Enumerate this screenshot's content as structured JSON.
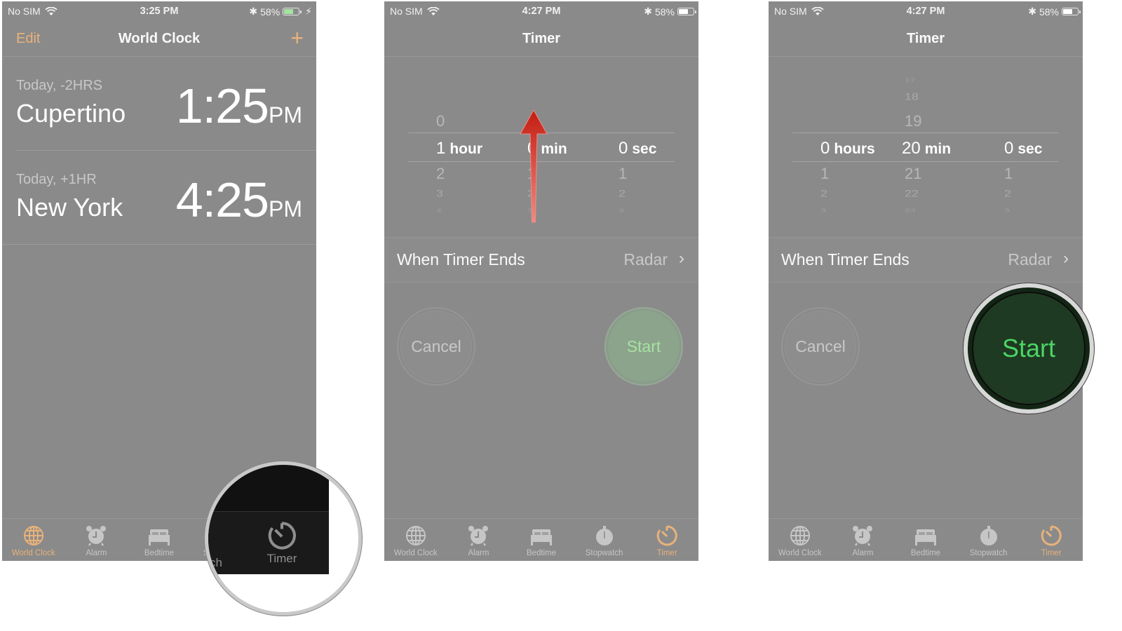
{
  "status_bar_common": {
    "carrier": "No SIM",
    "battery": "58%"
  },
  "panels": [
    {
      "status_time": "3:25 PM",
      "nav": {
        "edit_label": "Edit",
        "title": "World Clock",
        "add_icon": "plus-icon"
      },
      "clocks": [
        {
          "offset": "Today, -2HRS",
          "city": "Cupertino",
          "time": "1:25",
          "ampm": "PM"
        },
        {
          "offset": "Today, +1HR",
          "city": "New York",
          "time": "4:25",
          "ampm": "PM"
        }
      ],
      "magnifier": {
        "partial_label": "ch",
        "highlight_label": "Timer"
      }
    },
    {
      "status_time": "4:27 PM",
      "nav": {
        "title": "Timer"
      },
      "picker": {
        "hours": {
          "above": [
            "0"
          ],
          "selected": "1",
          "unit": "hour",
          "below": [
            "2",
            "3",
            "4"
          ]
        },
        "minutes": {
          "above": [],
          "selected": "0",
          "unit": "min",
          "below": [
            "1",
            "2",
            "3"
          ]
        },
        "seconds": {
          "above": [],
          "selected": "0",
          "unit": "sec",
          "below": [
            "1",
            "2",
            "3"
          ]
        }
      },
      "when_timer_ends": {
        "label": "When Timer Ends",
        "value": "Radar"
      },
      "buttons": {
        "cancel": "Cancel",
        "start": "Start"
      },
      "annotation": "swipe-up-arrow"
    },
    {
      "status_time": "4:27 PM",
      "nav": {
        "title": "Timer"
      },
      "picker": {
        "hours": {
          "above": [],
          "selected": "0",
          "unit": "hours",
          "below": [
            "1",
            "2",
            "3"
          ]
        },
        "minutes": {
          "above": [
            "17",
            "18",
            "19"
          ],
          "selected": "20",
          "unit": "min",
          "below": [
            "21",
            "22",
            "23"
          ]
        },
        "seconds": {
          "above": [],
          "selected": "0",
          "unit": "sec",
          "below": [
            "1",
            "2",
            "3"
          ]
        }
      },
      "when_timer_ends": {
        "label": "When Timer Ends",
        "value": "Radar"
      },
      "buttons": {
        "cancel": "Cancel",
        "start": "Start"
      }
    }
  ],
  "tabs": [
    {
      "label": "World Clock",
      "icon": "globe-icon"
    },
    {
      "label": "Alarm",
      "icon": "alarm-clock-icon"
    },
    {
      "label": "Bedtime",
      "icon": "bed-icon"
    },
    {
      "label": "Stopwatch",
      "icon": "stopwatch-icon"
    },
    {
      "label": "Timer",
      "icon": "timer-icon"
    }
  ],
  "colors": {
    "accent_orange": "#e8b27a",
    "start_green": "#4cd464",
    "start_bg": "#1e3a22",
    "annotation_red": "#d42a1e"
  }
}
